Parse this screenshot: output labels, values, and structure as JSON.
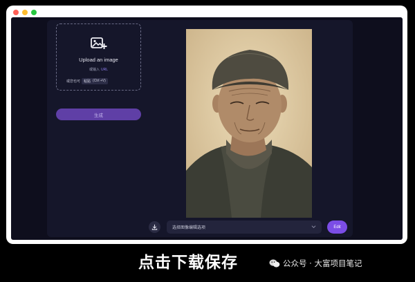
{
  "window": {
    "traffic_lights": [
      {
        "name": "close",
        "color": "#fe5f57"
      },
      {
        "name": "minimize",
        "color": "#febc2e"
      },
      {
        "name": "zoom",
        "color": "#28c840"
      }
    ]
  },
  "upload": {
    "icon": "image-add-icon",
    "title": "Upload an image",
    "url_prefix": "或输入",
    "url_link": "URL",
    "paste_label": "或您也可",
    "paste_action": "粘贴",
    "paste_shortcut": "(Ctrl +V)"
  },
  "generate_button": "生成",
  "image": {
    "subject": "elderly man portrait",
    "icon": "portrait-photo"
  },
  "bottom_bar": {
    "download_icon": "download-icon",
    "select_value": "选择图像编辑选项",
    "chevron_icon": "chevron-down-icon",
    "edit_button": "Edit"
  },
  "caption": "点击下载保存",
  "watermark": {
    "icon": "wechat-icon",
    "text": "公众号 · 大富项目笔记"
  },
  "colors": {
    "accent": "#7b4de6",
    "generate_button": "#5f3fa6",
    "app_background": "#0e0e1d",
    "panel_background": "#15162a"
  }
}
